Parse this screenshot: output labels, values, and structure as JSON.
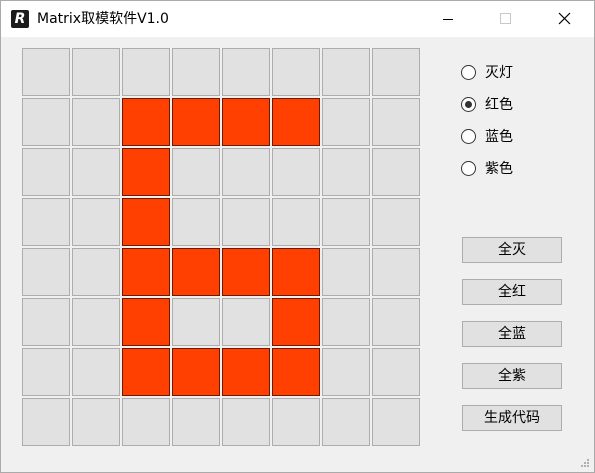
{
  "window": {
    "title": "Matrix取模软件V1.0",
    "icon_letter": "R",
    "controls": [
      "minimize-icon",
      "maximize-icon",
      "close-icon"
    ]
  },
  "matrix": {
    "rows": 8,
    "cols": 8,
    "off_color": "#e1e1e1",
    "on_color": "#ff4000",
    "cells": [
      [
        0,
        0,
        0,
        0,
        0,
        0,
        0,
        0
      ],
      [
        0,
        0,
        1,
        1,
        1,
        1,
        0,
        0
      ],
      [
        0,
        0,
        1,
        0,
        0,
        0,
        0,
        0
      ],
      [
        0,
        0,
        1,
        0,
        0,
        0,
        0,
        0
      ],
      [
        0,
        0,
        1,
        1,
        1,
        1,
        0,
        0
      ],
      [
        0,
        0,
        1,
        0,
        0,
        1,
        0,
        0
      ],
      [
        0,
        0,
        1,
        1,
        1,
        1,
        0,
        0
      ],
      [
        0,
        0,
        0,
        0,
        0,
        0,
        0,
        0
      ]
    ]
  },
  "color_options": [
    {
      "label": "灭灯",
      "selected": false
    },
    {
      "label": "红色",
      "selected": true
    },
    {
      "label": "蓝色",
      "selected": false
    },
    {
      "label": "紫色",
      "selected": false
    }
  ],
  "buttons": {
    "all_off": "全灭",
    "all_red": "全红",
    "all_blue": "全蓝",
    "all_purple": "全紫",
    "generate_code": "生成代码"
  }
}
